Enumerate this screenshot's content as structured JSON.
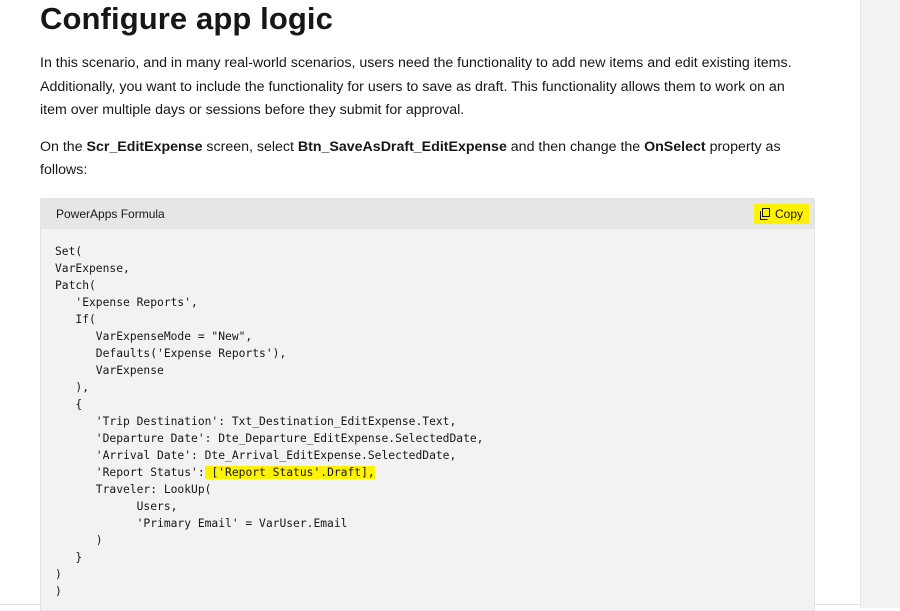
{
  "page": {
    "title": "Configure app logic",
    "paragraph1": "In this scenario, and in many real-world scenarios, users need the functionality to add new items and edit existing items. Additionally, you want to include the functionality for users to save as draft. This functionality allows them to work on an item over multiple days or sessions before they submit for approval.",
    "paragraph2": {
      "t1": "On the ",
      "b1": "Scr_EditExpense",
      "t2": " screen, select ",
      "b2": "Btn_SaveAsDraft_EditExpense",
      "t3": " and then change the ",
      "b3": "OnSelect",
      "t4": " property as follows:"
    }
  },
  "code_block": {
    "language": "PowerApps Formula",
    "copy_label": "Copy",
    "copy_icon": "copy-icon",
    "code_before_highlight": "Set(\nVarExpense,\nPatch(\n   'Expense Reports',\n   If(\n      VarExpenseMode = \"New\",\n      Defaults('Expense Reports'),\n      VarExpense\n   ),\n   {\n      'Trip Destination': Txt_Destination_EditExpense.Text,\n      'Departure Date': Dte_Departure_EditExpense.SelectedDate,\n      'Arrival Date': Dte_Arrival_EditExpense.SelectedDate,\n      'Report Status':",
    "code_highlight": " ['Report Status'.Draft],",
    "code_after_highlight": "\n      Traveler: LookUp(\n            Users,\n            'Primary Email' = VarUser.Email\n      )\n   }\n)\n)",
    "highlight_color": "#fff200"
  }
}
